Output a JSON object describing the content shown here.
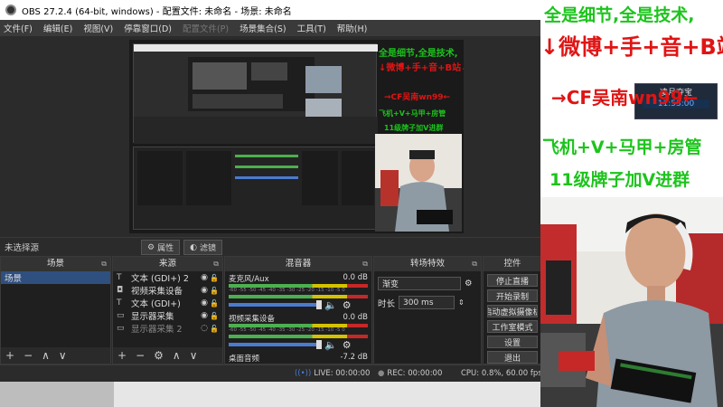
{
  "window": {
    "title": "OBS 27.2.4 (64-bit, windows) - 配置文件: 未命名 - 场景: 未命名"
  },
  "menu": [
    {
      "label": "文件(F)",
      "enabled": true
    },
    {
      "label": "编辑(E)",
      "enabled": true
    },
    {
      "label": "视图(V)",
      "enabled": true
    },
    {
      "label": "停靠窗口(D)",
      "enabled": true
    },
    {
      "label": "配置文件(P)",
      "enabled": false
    },
    {
      "label": "场景集合(S)",
      "enabled": true
    },
    {
      "label": "工具(T)",
      "enabled": true
    },
    {
      "label": "帮助(H)",
      "enabled": true
    }
  ],
  "status_row": {
    "no_source": "未选择源",
    "properties": "属性",
    "filters": "滤镜"
  },
  "scenes": {
    "title": "场景",
    "items": [
      "场景"
    ]
  },
  "sources": {
    "title": "来源",
    "items": [
      {
        "icon": "T",
        "label": "文本 (GDI+) 2"
      },
      {
        "icon": "cam",
        "label": "视频采集设备"
      },
      {
        "icon": "T",
        "label": "文本 (GDI+)"
      },
      {
        "icon": "mon",
        "label": "显示器采集"
      },
      {
        "icon": "mon",
        "label": "显示器采集 2"
      }
    ]
  },
  "mixer": {
    "title": "混音器",
    "channels": [
      {
        "name": "麦克风/Aux",
        "level": "0.0 dB"
      },
      {
        "name": "视频采集设备",
        "level": "0.0 dB"
      },
      {
        "name": "桌面音频",
        "level": "-7.2 dB"
      }
    ],
    "scale": "-60 -55 -50 -45 -40 -35 -30 -25 -20 -15 -10 -5 0"
  },
  "transitions": {
    "title": "转场特效",
    "selected": "渐变",
    "duration_label": "时长",
    "duration_value": "300 ms"
  },
  "controls": {
    "title": "控件",
    "buttons": [
      "停止直播",
      "开始录制",
      "启动虚拟摄像机",
      "工作室模式",
      "设置",
      "退出"
    ]
  },
  "statusbar": {
    "live": "LIVE: 00:00:00",
    "rec": "REC: 00:00:00",
    "cpu": "CPU: 0.8%, 60.00 fps"
  },
  "overlay": {
    "line1": "全是细节,全是技术,",
    "line2": "↓微博+手+音+B站↓",
    "line3": "→CF吴南wn99←",
    "line4": "飞机+V+马甲+房管",
    "line5": "11级牌子加V进群",
    "room_label": "凌月夺宝",
    "clock": "11:53:00"
  },
  "colors": {
    "accent_green": "#1cc41c",
    "accent_red": "#e01414",
    "selection": "#2f4f7f"
  }
}
